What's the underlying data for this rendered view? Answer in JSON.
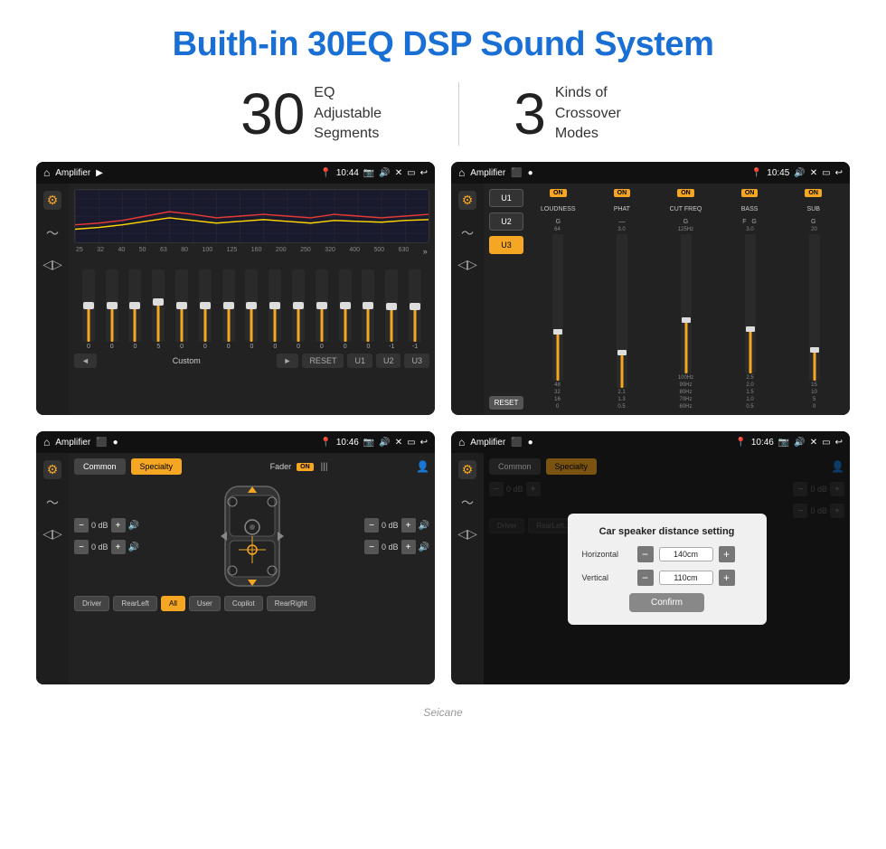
{
  "title": "Buith-in 30EQ DSP Sound System",
  "stats": [
    {
      "number": "30",
      "text": "EQ Adjustable\nSegments"
    },
    {
      "number": "3",
      "text": "Kinds of\nCrossoer Modes"
    }
  ],
  "screen1": {
    "status_bar": {
      "app": "Amplifier",
      "time": "10:44"
    },
    "freq_labels": [
      "25",
      "32",
      "40",
      "50",
      "63",
      "80",
      "100",
      "125",
      "160",
      "200",
      "250",
      "320",
      "400",
      "500",
      "630"
    ],
    "sliders": [
      50,
      50,
      50,
      55,
      50,
      50,
      50,
      50,
      50,
      50,
      50,
      50,
      50,
      49,
      49
    ],
    "values": [
      "0",
      "0",
      "0",
      "5",
      "0",
      "0",
      "0",
      "0",
      "0",
      "0",
      "0",
      "0",
      "0",
      "-1",
      "0",
      "-1"
    ],
    "bottom": [
      "◄",
      "Custom",
      "►",
      "RESET",
      "U1",
      "U2",
      "U3"
    ]
  },
  "screen2": {
    "status_bar": {
      "app": "Amplifier",
      "time": "10:45"
    },
    "presets": [
      "U1",
      "U2",
      "U3"
    ],
    "active_preset": "U3",
    "bands": [
      {
        "on": true,
        "name": "LOUDNESS"
      },
      {
        "on": true,
        "name": "PHAT"
      },
      {
        "on": true,
        "name": "CUT FREQ"
      },
      {
        "on": true,
        "name": "BASS"
      },
      {
        "on": true,
        "name": "SUB"
      }
    ],
    "reset_label": "RESET"
  },
  "screen3": {
    "status_bar": {
      "app": "Amplifier",
      "time": "10:46"
    },
    "tabs": [
      "Common",
      "Specialty"
    ],
    "active_tab": "Specialty",
    "fader_label": "Fader",
    "fader_on": "ON",
    "controls": {
      "left_top": "0 dB",
      "left_bottom": "0 dB",
      "right_top": "0 dB",
      "right_bottom": "0 dB"
    },
    "bottom_btns": [
      "Driver",
      "RearLeft",
      "All",
      "User",
      "Copilot",
      "RearRight"
    ]
  },
  "screen4": {
    "status_bar": {
      "app": "Amplifier",
      "time": "10:46"
    },
    "tabs": [
      "Common",
      "Specialty"
    ],
    "active_tab": "Specialty",
    "dialog": {
      "title": "Car speaker distance setting",
      "horizontal_label": "Horizontal",
      "horizontal_value": "140cm",
      "vertical_label": "Vertical",
      "vertical_value": "110cm",
      "confirm_label": "Confirm"
    },
    "controls": {
      "right_top": "0 dB",
      "right_bottom": "0 dB"
    },
    "bottom_btns": [
      "Driver",
      "RearLeft...",
      "All",
      "Copilot",
      "RearRight"
    ]
  },
  "watermark": "Seicane"
}
